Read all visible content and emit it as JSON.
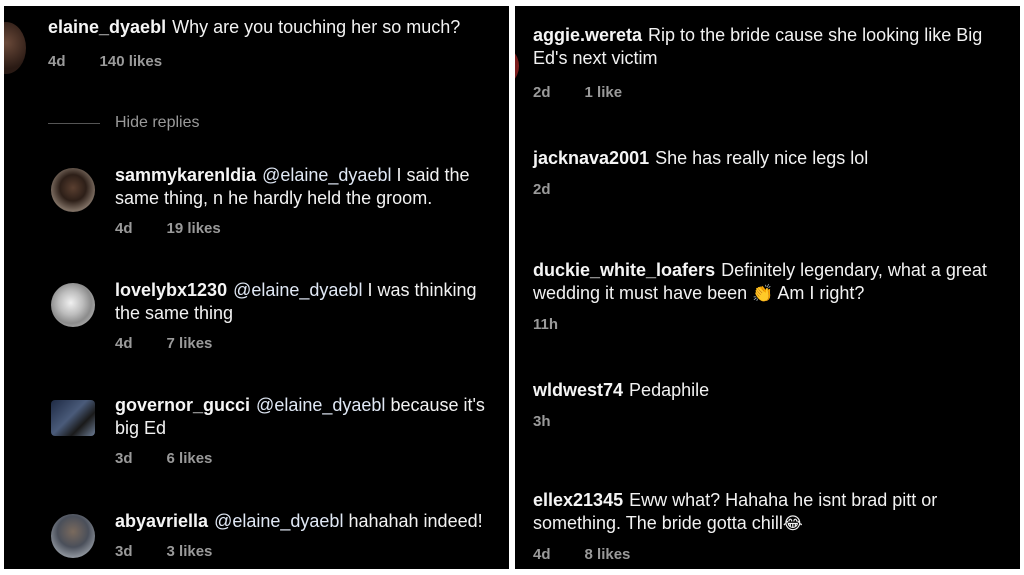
{
  "left": {
    "top_comment": {
      "user": "elaine_dyaebl",
      "text": "Why are you touching her so much?",
      "time": "4d",
      "likes": "140 likes"
    },
    "hide_replies": "Hide replies",
    "replies": [
      {
        "user": "sammykarenldia",
        "mention": "@elaine_dyaebl",
        "text": "I said the same thing, n he hardly held the groom.",
        "time": "4d",
        "likes": "19 likes"
      },
      {
        "user": "lovelybx1230",
        "mention": "@elaine_dyaebl",
        "text": "I was thinking the same thing",
        "time": "4d",
        "likes": "7 likes"
      },
      {
        "user": "governor_gucci",
        "mention": "@elaine_dyaebl",
        "text": "because it's big Ed",
        "time": "3d",
        "likes": "6 likes"
      },
      {
        "user": "abyavriella",
        "mention": "@elaine_dyaebl",
        "text": "hahahah indeed!",
        "time": "3d",
        "likes": "3 likes"
      }
    ]
  },
  "right": {
    "comments": [
      {
        "user": "aggie.wereta",
        "text": "Rip to the bride cause she looking like Big Ed's next victim",
        "time": "2d",
        "likes": "1 like"
      },
      {
        "user": "jacknava2001",
        "text": "She has really nice legs lol",
        "time": "2d",
        "likes": ""
      },
      {
        "user": "duckie_white_loafers",
        "text": "Definitely legendary,  what a great wedding it must have been",
        "emoji": "👏",
        "text2": "Am I right?",
        "time": "11h",
        "likes": ""
      },
      {
        "user": "wldwest74",
        "text": "Pedaphile",
        "time": "3h",
        "likes": ""
      },
      {
        "user": "ellex21345",
        "text": "Eww what? Hahaha he isnt brad pitt or something. The bride gotta chill",
        "emoji": "😂",
        "time": "4d",
        "likes": "8 likes"
      }
    ]
  }
}
